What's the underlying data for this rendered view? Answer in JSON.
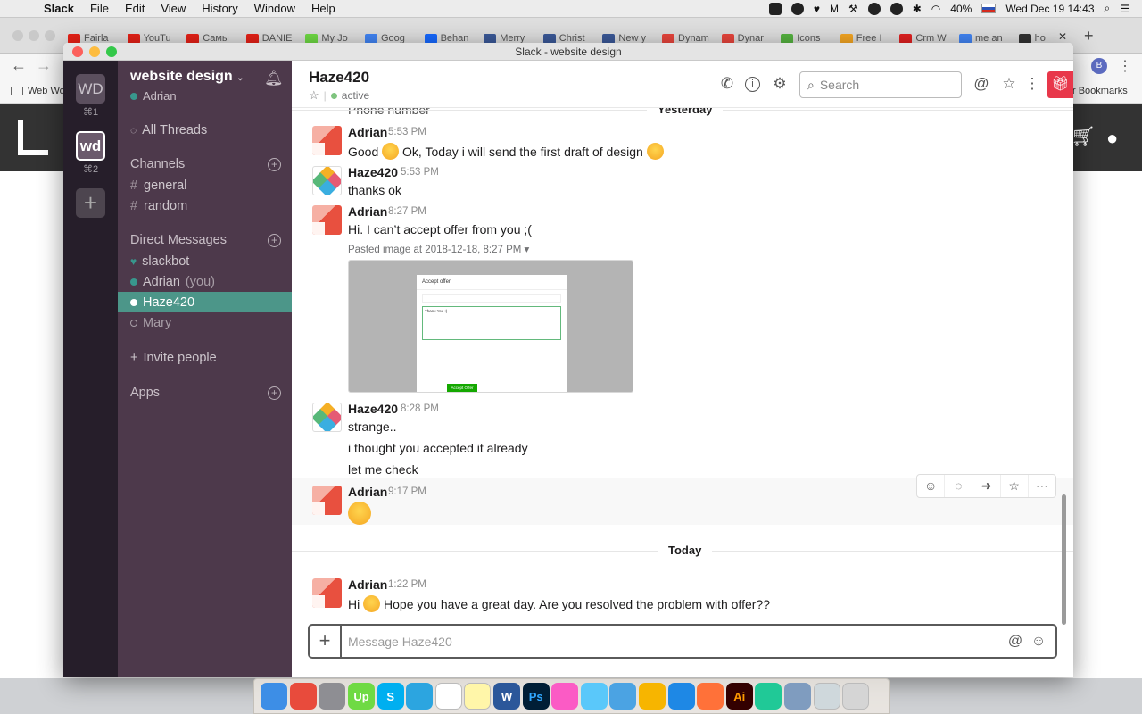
{
  "menubar": {
    "app_name": "Slack",
    "menus": [
      "File",
      "Edit",
      "View",
      "History",
      "Window",
      "Help"
    ],
    "battery": "40%",
    "clock": "Wed Dec 19  14:43"
  },
  "browser": {
    "tabs": [
      {
        "label": "Fairla",
        "color": "#e62117"
      },
      {
        "label": "YouTu",
        "color": "#e62117"
      },
      {
        "label": "Самы",
        "color": "#e62117"
      },
      {
        "label": "DANIE",
        "color": "#e62117"
      },
      {
        "label": "My Jo",
        "color": "#6fda44"
      },
      {
        "label": "Goog",
        "color": "#4285f4"
      },
      {
        "label": "Behan",
        "color": "#1769ff"
      },
      {
        "label": "Merry",
        "color": "#3b5998"
      },
      {
        "label": "Christ",
        "color": "#3b5998"
      },
      {
        "label": "New y",
        "color": "#3b5998"
      },
      {
        "label": "Dynam",
        "color": "#e8453c"
      },
      {
        "label": "Dynar",
        "color": "#e8453c"
      },
      {
        "label": "Icons",
        "color": "#55b340"
      },
      {
        "label": "Free I",
        "color": "#f5a623"
      },
      {
        "label": "Crm W",
        "color": "#e02020"
      },
      {
        "label": "me an",
        "color": "#4285f4"
      },
      {
        "label": "ho",
        "color": "#333333"
      }
    ],
    "bookmark_left": "Web Wo",
    "bookmark_right": "r Bookmarks"
  },
  "window_title": "Slack - website design",
  "teams": [
    {
      "abbr": "WD",
      "shortcut": "⌘1"
    },
    {
      "abbr": "wd",
      "shortcut": "⌘2"
    }
  ],
  "sidebar": {
    "workspace_name": "website design",
    "user": "Adrian",
    "all_threads": "All Threads",
    "channels_header": "Channels",
    "channels": [
      "general",
      "random"
    ],
    "dm_header": "Direct Messages",
    "dms": [
      {
        "name": "slackbot",
        "suffix": ""
      },
      {
        "name": "Adrian",
        "suffix": "(you)"
      },
      {
        "name": "Haze420",
        "suffix": ""
      },
      {
        "name": "Mary",
        "suffix": ""
      }
    ],
    "invite": "Invite people",
    "apps_header": "Apps"
  },
  "channel": {
    "name": "Haze420",
    "status": "active",
    "search_placeholder": "Search"
  },
  "messages": {
    "partial_top": "Phone number",
    "yesterday_label": "Yesterday",
    "today_label": "Today",
    "m1": {
      "author": "Adrian",
      "time": "5:53 PM",
      "text_a": "Good",
      "text_b": "Ok, Today i will send the first draft of design"
    },
    "m2": {
      "author": "Haze420",
      "time": "5:53 PM",
      "text": "thanks ok"
    },
    "m3": {
      "author": "Adrian",
      "time": "8:27 PM",
      "text": "Hi. I can’t accept offer from you ;(",
      "attachment_label": "Pasted image at 2018-12-18, 8:27 PM ▾",
      "dialog_title": "Accept offer",
      "dialog_field_text": "Thank You :)",
      "dialog_button": "Accept Offer"
    },
    "m4": {
      "author": "Haze420",
      "time": "8:28 PM",
      "lines": [
        "strange..",
        "i thought you accepted it already",
        "let me check"
      ]
    },
    "m5": {
      "author": "Adrian",
      "time": "9:17 PM"
    },
    "m6": {
      "author": "Adrian",
      "time": "1:22 PM",
      "text_a": "Hi",
      "text_b": "Hope you have a great day. Are you resolved the problem with offer??"
    }
  },
  "composer": {
    "placeholder": "Message Haze420"
  },
  "icons": {
    "apple": "apple-icon",
    "bell": "bell-icon",
    "phone": "phone-icon",
    "info": "info-icon",
    "gear": "gear-icon",
    "at": "at-icon",
    "star": "star-icon",
    "more": "more-vertical-icon",
    "gift": "gift-icon",
    "emoji": "wink-emoji-icon"
  },
  "colors": {
    "sidebar": "#4d394b",
    "active_dm": "#4c9689",
    "team_rail": "#261e2a",
    "presence": "#38978d",
    "gift": "#e8374a"
  },
  "dock": {
    "apps": [
      {
        "name": "finder",
        "color": "#3d8ee6"
      },
      {
        "name": "chrome",
        "color": "#e84b3c"
      },
      {
        "name": "system-preferences",
        "color": "#8e8e93"
      },
      {
        "name": "upwork",
        "color": "#6fda44",
        "label": "Up"
      },
      {
        "name": "skype",
        "color": "#00aff0",
        "label": "S"
      },
      {
        "name": "telegram",
        "color": "#2ca5e0"
      },
      {
        "name": "slack",
        "color": "#ffffff"
      },
      {
        "name": "notes",
        "color": "#fff6a9"
      },
      {
        "name": "word",
        "color": "#2b579a",
        "label": "W"
      },
      {
        "name": "photoshop",
        "color": "#001e36",
        "label": "Ps"
      },
      {
        "name": "itunes",
        "color": "#fb5bc5"
      },
      {
        "name": "messages",
        "color": "#5ac8fa"
      },
      {
        "name": "feather",
        "color": "#4ba3e3"
      },
      {
        "name": "sketch",
        "color": "#f7b500"
      },
      {
        "name": "safari",
        "color": "#1e88e5"
      },
      {
        "name": "firefox",
        "color": "#ff7139"
      },
      {
        "name": "illustrator",
        "color": "#330000",
        "label": "Ai"
      },
      {
        "name": "drop",
        "color": "#20c997"
      },
      {
        "name": "preview",
        "color": "#7f9cbf"
      },
      {
        "name": "folder",
        "color": "#cfd8dc"
      },
      {
        "name": "trash",
        "color": "#d5d5d5"
      }
    ]
  }
}
